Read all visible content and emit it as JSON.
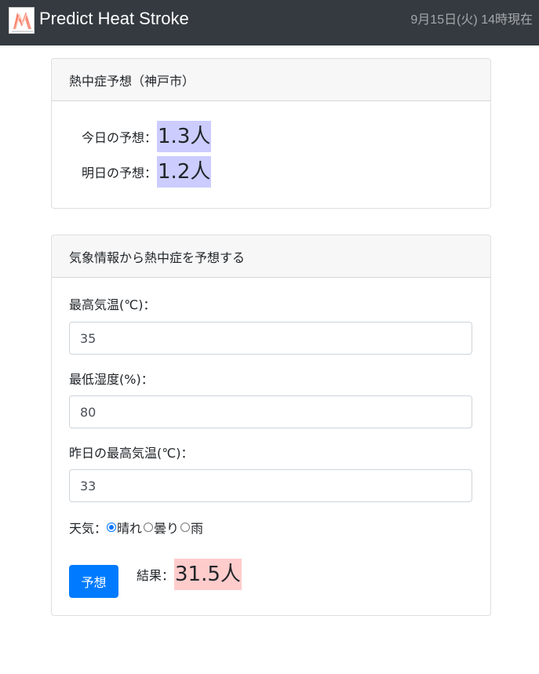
{
  "header": {
    "logo_icon": "predict-heat-stroke-logo",
    "logo_caption": "Predict Heat Stroke",
    "title": "Predict Heat Stroke",
    "datetime": "9月15日(火) 14時現在",
    "background_color": "#343a40"
  },
  "forecast_card": {
    "title": "熱中症予想（神戸市）",
    "today_label": "今日の予想：",
    "today_value": "1.3人",
    "tomorrow_label": "明日の予想：",
    "tomorrow_value": "1.2人",
    "value_highlight_color": "#ccccff"
  },
  "predict_card": {
    "title": "気象情報から熱中症を予想する",
    "max_temp_label": "最高気温(℃)：",
    "max_temp_value": "35",
    "min_humidity_label": "最低湿度(%)：",
    "min_humidity_value": "80",
    "yesterday_max_temp_label": "昨日の最高気温(℃)：",
    "yesterday_max_temp_value": "33",
    "weather_label": "天気：",
    "weather_options": [
      {
        "label": "晴れ",
        "checked": true
      },
      {
        "label": "曇り",
        "checked": false
      },
      {
        "label": "雨",
        "checked": false
      }
    ],
    "predict_button_label": "予想",
    "result_label": "結果：",
    "result_value": "31.5人",
    "result_highlight_color": "#ffcccc",
    "button_color": "#007bff"
  }
}
